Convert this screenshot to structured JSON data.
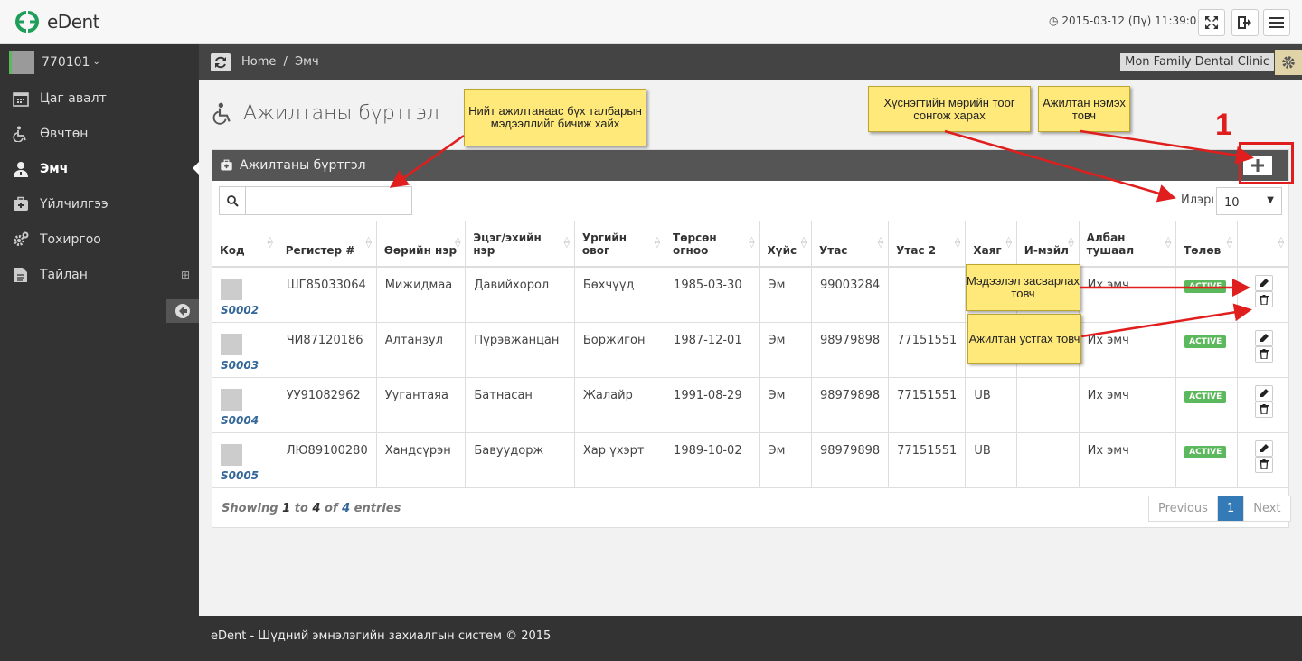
{
  "app": {
    "brand": "eDent",
    "clock": "2015-03-12 (Пү) 11:39:0"
  },
  "user": {
    "name": "770101"
  },
  "sidebar": {
    "items": [
      {
        "label": "Цаг авалт",
        "icon": "calendar-icon"
      },
      {
        "label": "Өвчтөн",
        "icon": "wheelchair-icon"
      },
      {
        "label": "Эмч",
        "icon": "doctor-icon"
      },
      {
        "label": "Үйлчилгээ",
        "icon": "medkit-icon"
      },
      {
        "label": "Тохиргоо",
        "icon": "cogs-icon"
      },
      {
        "label": "Тайлан",
        "icon": "file-icon"
      }
    ]
  },
  "breadcrumb": {
    "home": "Home",
    "sep": "/",
    "current": "Эмч"
  },
  "clinic": "Mon Family Dental Clinic",
  "page": {
    "title": "Ажилтаны бүртгэл"
  },
  "panel": {
    "title": "Ажилтаны бүртгэл",
    "search_placeholder": "",
    "length_label": "Илэрц:",
    "length_value": "10"
  },
  "table": {
    "headers": [
      "Код",
      "Регистер #",
      "Өөрийн нэр",
      "Эцэг/эхийн нэр",
      "Ургийн овог",
      "Төрсөн огноо",
      "Хүйс",
      "Утас",
      "Утас 2",
      "Хаяг",
      "И-мэйл",
      "Албан тушаал",
      "Төлөв",
      ""
    ],
    "rows": [
      {
        "code": "S0002",
        "reg": "ШГ85033064",
        "name": "Мижидмаа",
        "parent": "Давийхорол",
        "clan": "Бөхчүүд",
        "dob": "1985-03-30",
        "sex": "Эм",
        "phone": "99003284",
        "phone2": "",
        "addr": "",
        "email": "",
        "pos": "Их эмч",
        "status": "ACTIVE"
      },
      {
        "code": "S0003",
        "reg": "ЧИ87120186",
        "name": "Алтанзул",
        "parent": "Пүрэвжанцан",
        "clan": "Боржигон",
        "dob": "1987-12-01",
        "sex": "Эм",
        "phone": "98979898",
        "phone2": "77151551",
        "addr": "",
        "email": "",
        "pos": "Их эмч",
        "status": "ACTIVE"
      },
      {
        "code": "S0004",
        "reg": "УУ91082962",
        "name": "Уугантаяа",
        "parent": "Батнасан",
        "clan": "Жалайр",
        "dob": "1991-08-29",
        "sex": "Эм",
        "phone": "98979898",
        "phone2": "77151551",
        "addr": "UB",
        "email": "",
        "pos": "Их эмч",
        "status": "ACTIVE"
      },
      {
        "code": "S0005",
        "reg": "ЛЮ89100280",
        "name": "Хандсүрэн",
        "parent": "Бавуудорж",
        "clan": "Хар үхэрт",
        "dob": "1989-10-02",
        "sex": "Эм",
        "phone": "98979898",
        "phone2": "77151551",
        "addr": "UB",
        "email": "",
        "pos": "Их эмч",
        "status": "ACTIVE"
      }
    ]
  },
  "info": {
    "showing": "Showing",
    "from": "1",
    "to_word": "to",
    "to": "4",
    "of_word": "of",
    "total": "4",
    "entries": "entries"
  },
  "pagination": {
    "previous": "Previous",
    "current": "1",
    "next": "Next"
  },
  "footer": "eDent - Шүдний эмнэлэгийн захиалгын систем © 2015",
  "annotations": {
    "search": "Нийт ажилтанаас бүх талбарын мэдээллийг бичиж хайх",
    "rows": "Хүснэгтийн мөрийн тоог сонгож харах",
    "add": "Ажилтан нэмэх товч",
    "edit": "Мэдээлэл засварлах товч",
    "delete": "Ажилтан устгах товч",
    "marker": "1"
  },
  "colors": {
    "accent": "#337ab7",
    "active": "#5cb85c",
    "callout": "#ffe97a",
    "arrow": "#e01e1e",
    "sidebar": "#333333"
  }
}
